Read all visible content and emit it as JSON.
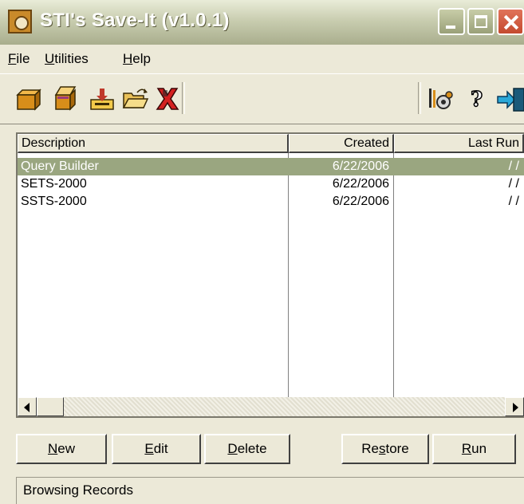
{
  "window": {
    "title": "STI's Save-It (v1.0.1)"
  },
  "menu": {
    "file": {
      "accel": "F",
      "rest": "ile"
    },
    "utilities": {
      "accel": "U",
      "rest": "tilities"
    },
    "help": {
      "accel": "H",
      "rest": "elp"
    }
  },
  "toolbar_icons": [
    "new-box-icon",
    "open-box-icon",
    "import-tray-icon",
    "open-folder-icon",
    "delete-x-icon",
    "settings-gears-icon",
    "help-question-icon",
    "exit-door-icon"
  ],
  "list": {
    "columns": {
      "description": "Description",
      "created": "Created",
      "last_run": "Last Run"
    },
    "rows": [
      {
        "description": "Query Builder",
        "created": "6/22/2006",
        "last_run": "/ /",
        "selected": true
      },
      {
        "description": "SETS-2000",
        "created": "6/22/2006",
        "last_run": "/ /",
        "selected": false
      },
      {
        "description": "SSTS-2000",
        "created": "6/22/2006",
        "last_run": "/ /",
        "selected": false
      }
    ]
  },
  "buttons": {
    "new": {
      "accel": "N",
      "rest": "ew"
    },
    "edit": {
      "accel": "E",
      "rest": "dit"
    },
    "delete": {
      "accel": "D",
      "rest": "elete"
    },
    "restore": {
      "pre": "Re",
      "accel": "s",
      "rest": "tore"
    },
    "run": {
      "accel": "R",
      "rest": "un"
    }
  },
  "status": {
    "text": "Browsing Records"
  },
  "colors": {
    "selected_row": "#9aa680",
    "window_bg": "#ece9d8",
    "close_button": "#c44a2f"
  }
}
